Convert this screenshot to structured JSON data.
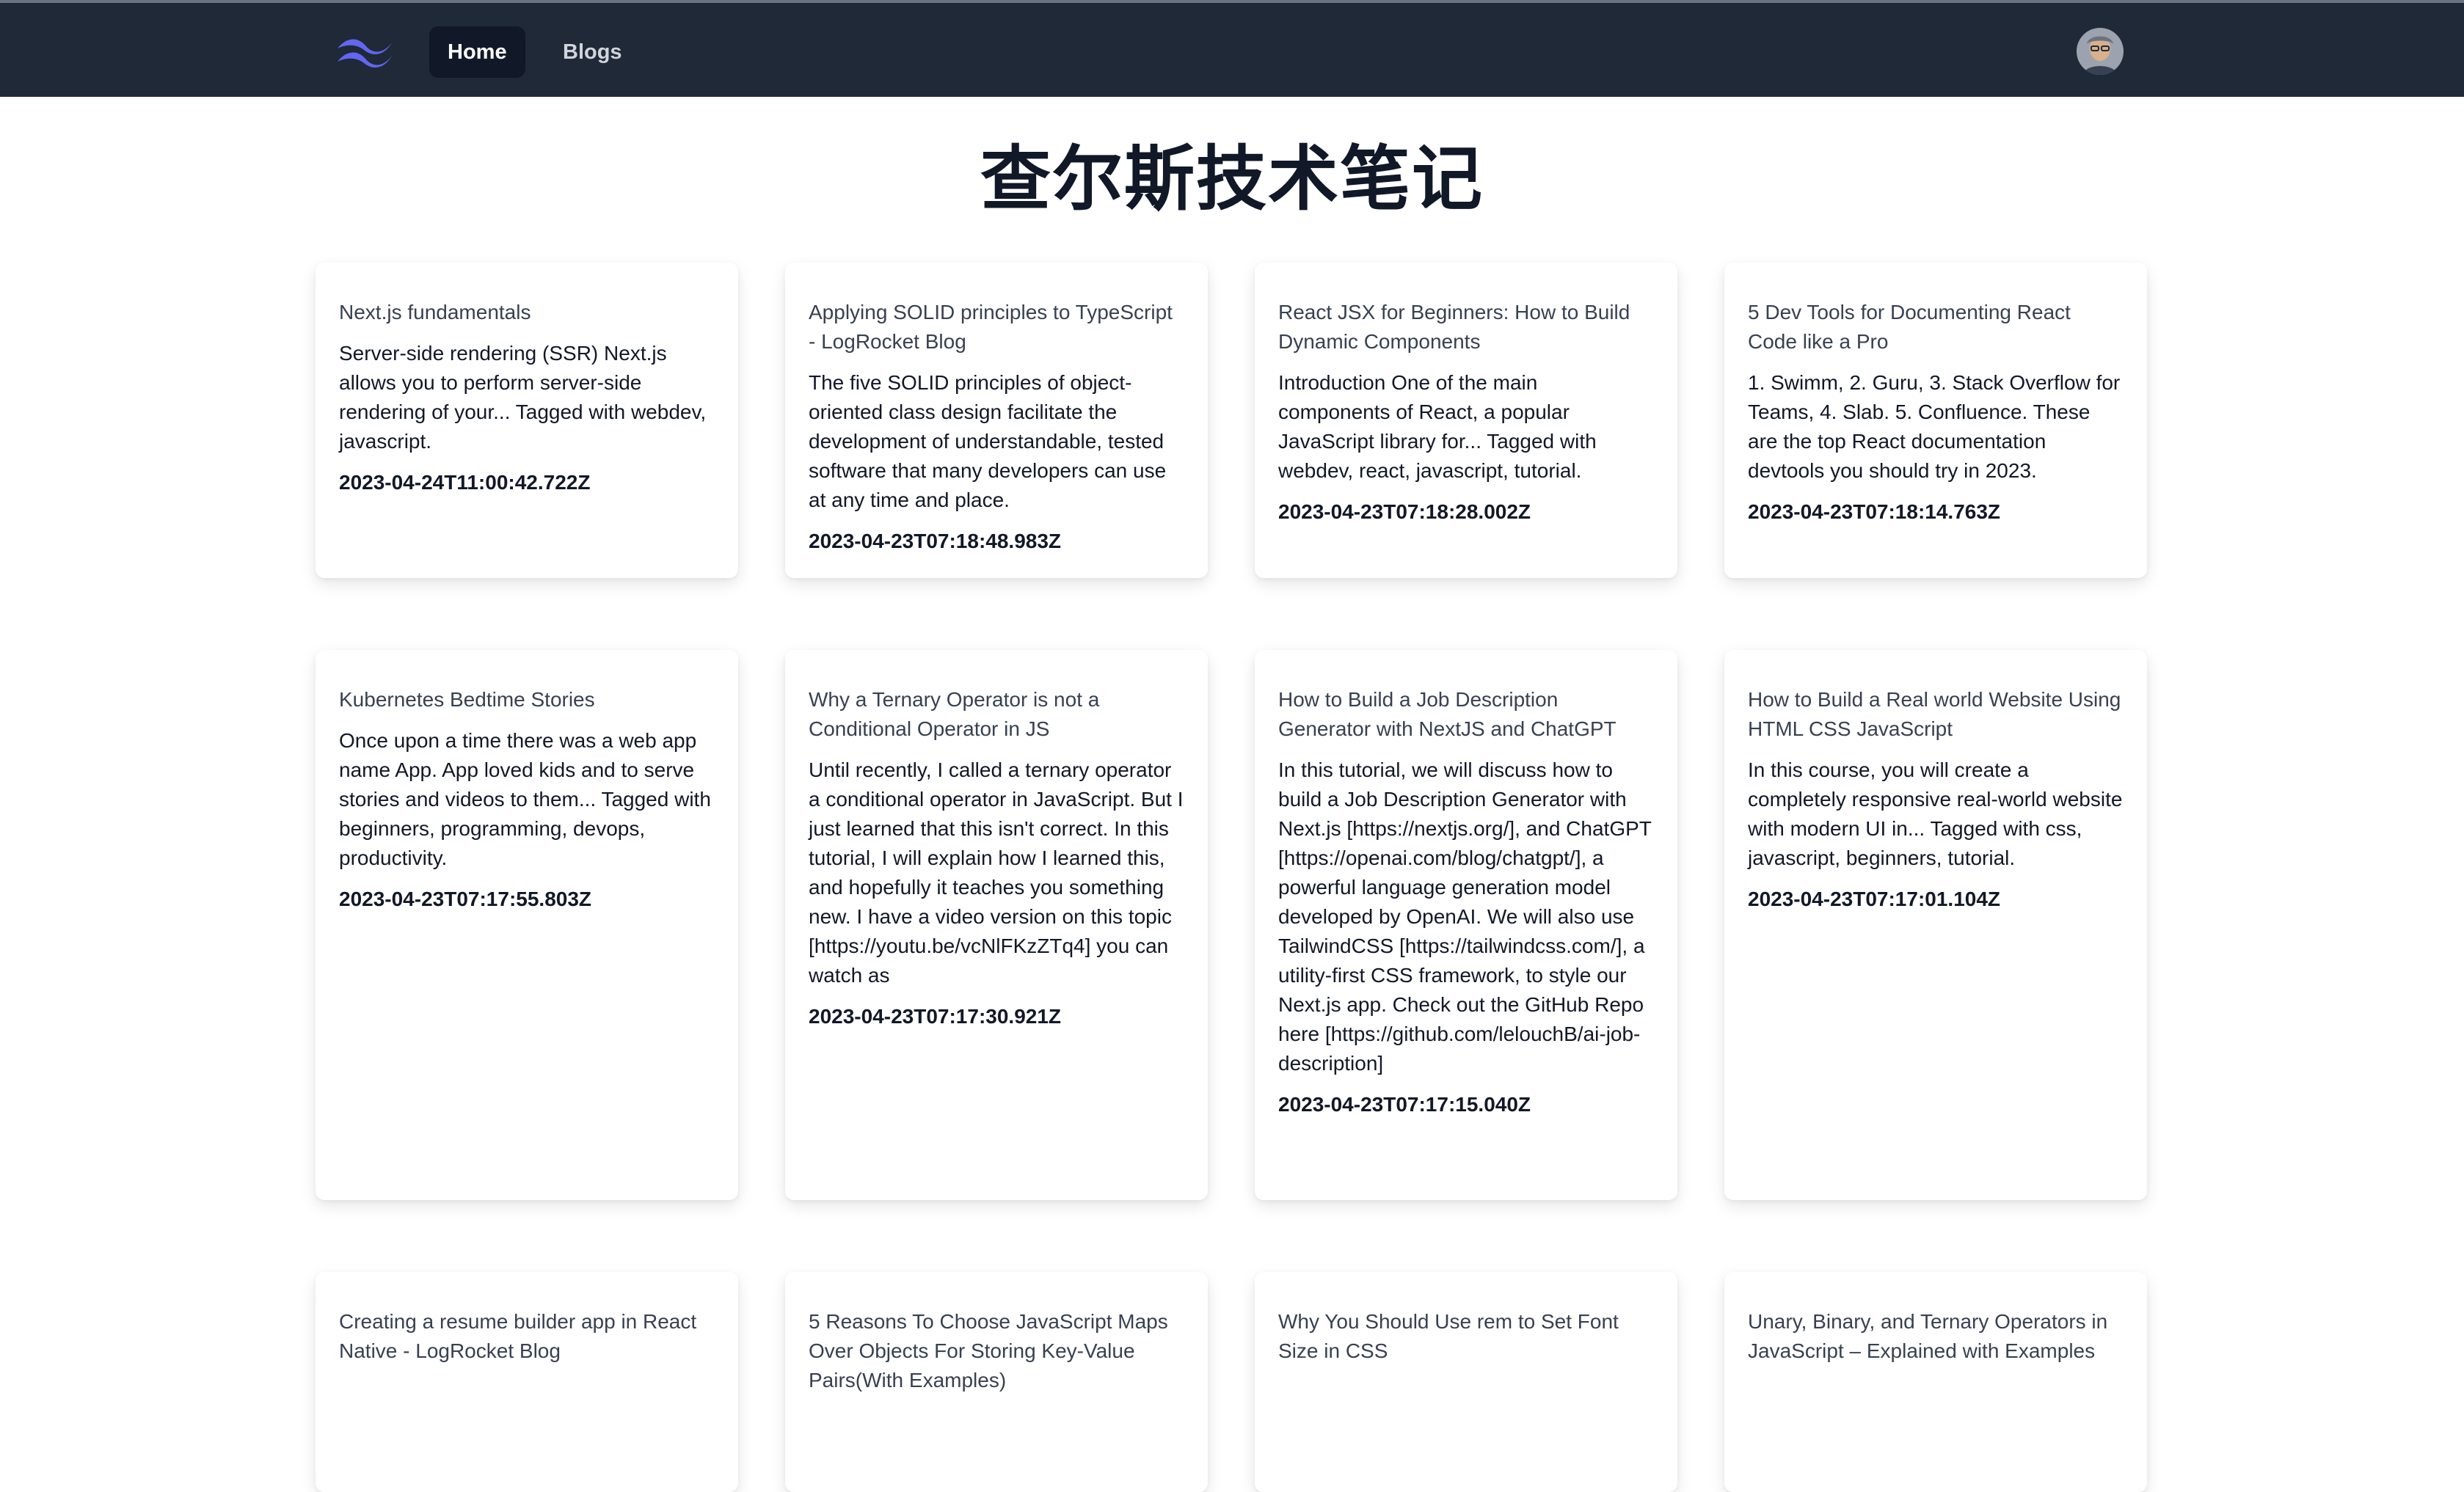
{
  "nav": {
    "items": [
      {
        "label": "Home",
        "active": true
      },
      {
        "label": "Blogs",
        "active": false
      }
    ],
    "logo_icon": "tailwind-logo-icon",
    "avatar_icon": "user-avatar",
    "accent_color": "#6366f1"
  },
  "page": {
    "title": "查尔斯技术笔记"
  },
  "cards": [
    {
      "title": "Next.js fundamentals",
      "description": "Server-side rendering (SSR) Next.js allows you to perform server-side rendering of your... Tagged with webdev, javascript.",
      "date": "2023-04-24T11:00:42.722Z"
    },
    {
      "title": "Applying SOLID principles to TypeScript - LogRocket Blog",
      "description": "The five SOLID principles of object-oriented class design facilitate the development of understandable, tested software that many developers can use at any time and place.",
      "date": "2023-04-23T07:18:48.983Z"
    },
    {
      "title": "React JSX for Beginners: How to Build Dynamic Components",
      "description": "Introduction One of the main components of React, a popular JavaScript library for... Tagged with webdev, react, javascript, tutorial.",
      "date": "2023-04-23T07:18:28.002Z"
    },
    {
      "title": "5 Dev Tools for Documenting React Code like a Pro",
      "description": "1. Swimm, 2. Guru, 3. Stack Overflow for Teams, 4. Slab. 5. Confluence. These are the top React documentation devtools you should try in 2023.",
      "date": "2023-04-23T07:18:14.763Z"
    },
    {
      "title": "Kubernetes Bedtime Stories",
      "description": "Once upon a time there was a web app name App. App loved kids and to serve stories and videos to them... Tagged with beginners, programming, devops, productivity.",
      "date": "2023-04-23T07:17:55.803Z"
    },
    {
      "title": "Why a Ternary Operator is not a Conditional Operator in JS",
      "description": "Until recently, I called a ternary operator a conditional operator in JavaScript. But I just learned that this isn't correct. In this tutorial, I will explain how I learned this, and hopefully it teaches you something new. I have a video version on this topic [https://youtu.be/vcNlFKzZTq4] you can watch as",
      "date": "2023-04-23T07:17:30.921Z"
    },
    {
      "title": "How to Build a Job Description Generator with NextJS and ChatGPT",
      "description": "In this tutorial, we will discuss how to build a Job Description Generator with Next.js [https://nextjs.org/], and ChatGPT [https://openai.com/blog/chatgpt/], a powerful language generation model developed by OpenAI. We will also use TailwindCSS [https://tailwindcss.com/], a utility-first CSS framework, to style our Next.js app. Check out the GitHub Repo here [https://github.com/lelouchB/ai-job-description]",
      "date": "2023-04-23T07:17:15.040Z"
    },
    {
      "title": "How to Build a Real world Website Using HTML CSS JavaScript",
      "description": "In this course, you will create a completely responsive real-world website with modern UI in... Tagged with css, javascript, beginners, tutorial.",
      "date": "2023-04-23T07:17:01.104Z"
    },
    {
      "title": "Creating a resume builder app in React Native - LogRocket Blog",
      "description": "",
      "date": ""
    },
    {
      "title": "5 Reasons To Choose JavaScript Maps Over Objects For Storing Key-Value Pairs(With Examples)",
      "description": "",
      "date": ""
    },
    {
      "title": "Why You Should Use rem to Set Font Size in CSS",
      "description": "",
      "date": ""
    },
    {
      "title": "Unary, Binary, and Ternary Operators in JavaScript – Explained with Examples",
      "description": "",
      "date": ""
    }
  ]
}
